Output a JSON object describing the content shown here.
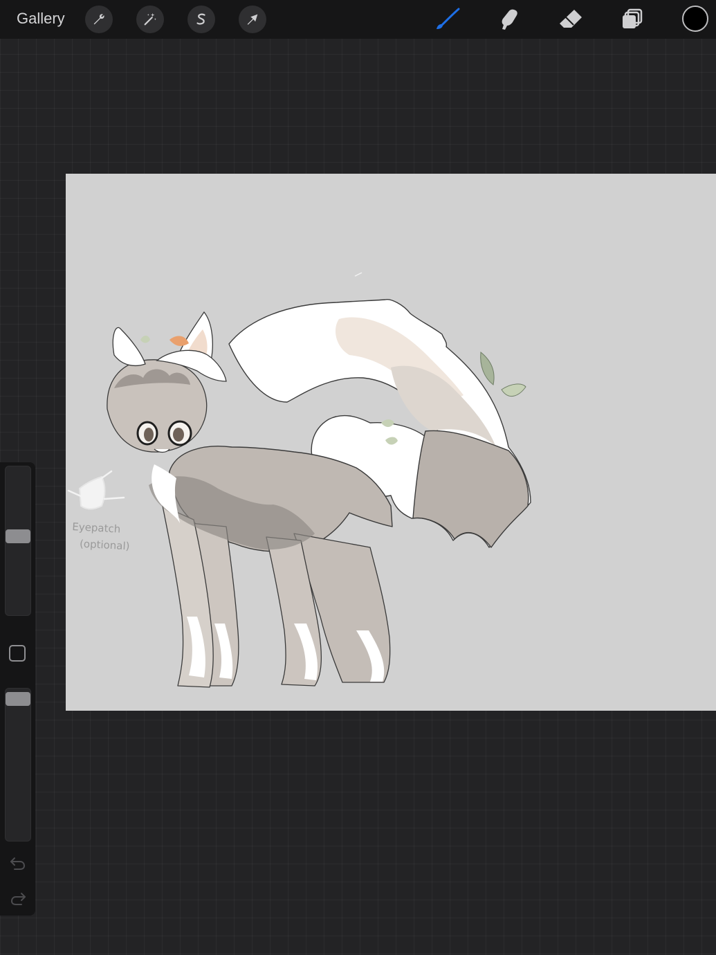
{
  "topbar": {
    "gallery_label": "Gallery",
    "left_tools": [
      {
        "name": "actions",
        "icon": "wrench-icon"
      },
      {
        "name": "adjustments",
        "icon": "magic-wand-icon"
      },
      {
        "name": "selection",
        "icon": "selection-s-icon"
      },
      {
        "name": "transform",
        "icon": "arrow-cursor-icon"
      }
    ],
    "right_tools": [
      {
        "name": "brush",
        "icon": "brush-icon",
        "active": true
      },
      {
        "name": "smudge",
        "icon": "smudge-finger-icon"
      },
      {
        "name": "eraser",
        "icon": "eraser-icon"
      },
      {
        "name": "layers",
        "icon": "layers-icon"
      }
    ],
    "current_color": "#000000",
    "active_color": "#1e6fe6"
  },
  "sidebar": {
    "brush_size_level": 0.45,
    "opacity_level": 0.05,
    "modify_icon": "square-icon",
    "undo_icon": "undo-icon",
    "redo_icon": "redo-icon"
  },
  "canvas": {
    "background": "#d1d1d1",
    "note_line1": "Eyepatch",
    "note_line2": "(optional)"
  }
}
